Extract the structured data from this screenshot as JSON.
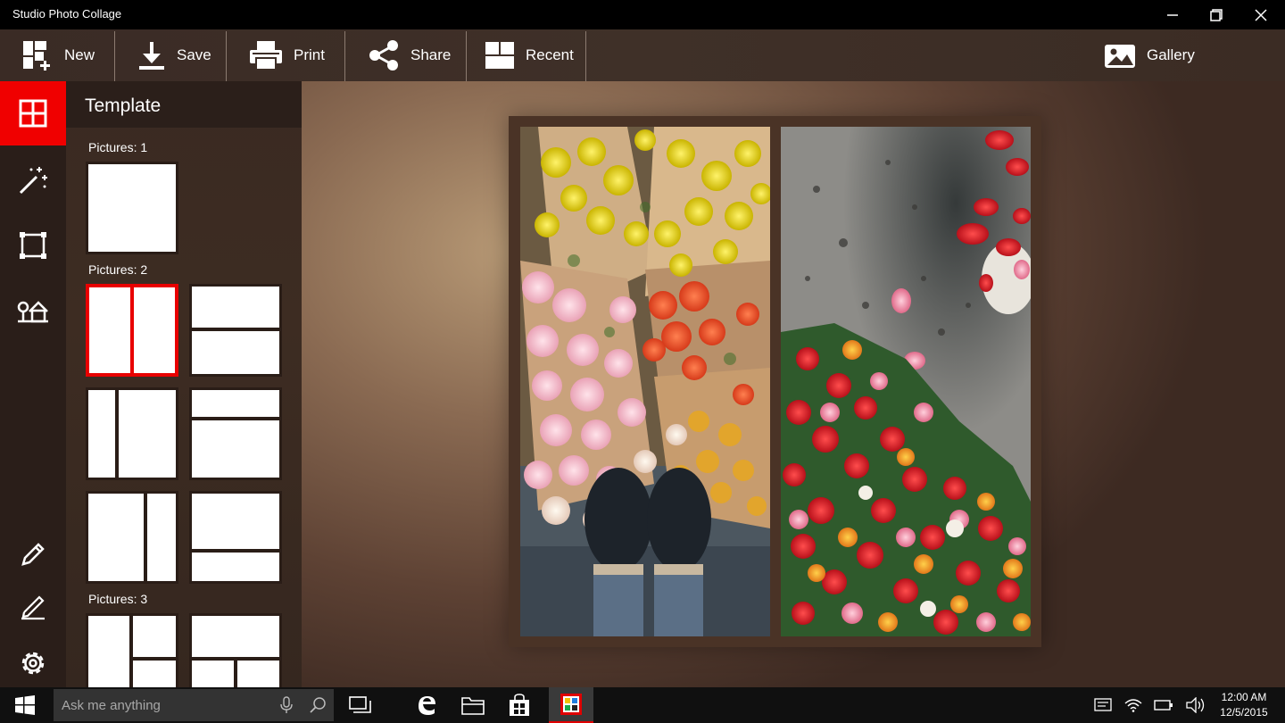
{
  "app": {
    "title": "Studio Photo Collage"
  },
  "window_controls": {
    "minimize_icon": "minimize-icon",
    "restore_icon": "restore-icon",
    "close_icon": "close-icon"
  },
  "toolbar": {
    "new_label": "New",
    "save_label": "Save",
    "print_label": "Print",
    "share_label": "Share",
    "recent_label": "Recent",
    "gallery_label": "Gallery"
  },
  "rail": {
    "items": [
      {
        "icon": "template-grid-icon",
        "active": true
      },
      {
        "icon": "magic-wand-icon",
        "active": false
      },
      {
        "icon": "frame-crop-icon",
        "active": false
      },
      {
        "icon": "background-scene-icon",
        "active": false
      },
      {
        "icon": "pencil-icon",
        "active": false
      },
      {
        "icon": "text-edit-icon",
        "active": false
      },
      {
        "icon": "settings-gear-icon",
        "active": false
      }
    ]
  },
  "panel": {
    "title": "Template",
    "groups": [
      {
        "label": "Pictures: 1"
      },
      {
        "label": "Pictures: 2"
      },
      {
        "label": "Pictures: 3"
      }
    ]
  },
  "taskbar": {
    "search_placeholder": "Ask me anything",
    "time": "12:00 AM",
    "date": "12/5/2015"
  },
  "colors": {
    "accent": "#f00000",
    "toolbar": "#3d2e27",
    "rail": "#2a1e19",
    "taskbar": "#101010"
  }
}
